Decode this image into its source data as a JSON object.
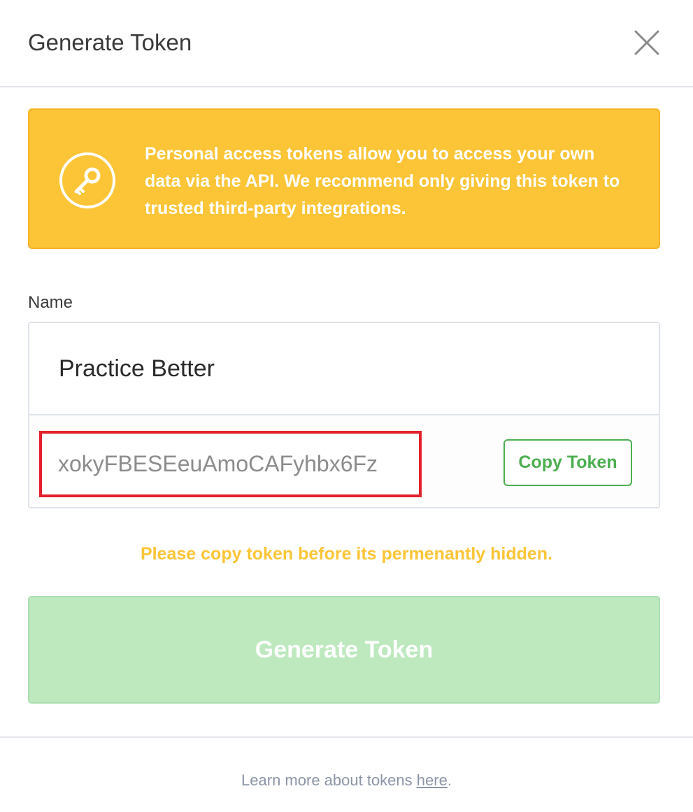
{
  "header": {
    "title": "Generate Token",
    "close_icon": "close-icon"
  },
  "notice": {
    "icon": "key-icon",
    "text": "Personal access tokens allow you to access your own data via the API. We recommend only giving this token to trusted third-party integrations.",
    "background_color": "#fbc537"
  },
  "form": {
    "name_label": "Name",
    "name_value": "Practice Better",
    "token_value": "xokyFBESEeuAmoCAFyhbx6Fz",
    "copy_button_label": "Copy Token"
  },
  "warning_text": "Please copy token before its permenantly hidden.",
  "generate_button_label": "Generate Token",
  "footer": {
    "text_before": "Learn more about tokens ",
    "link_text": "here",
    "text_after": "."
  },
  "colors": {
    "accent_green": "#4caf50",
    "warning_yellow": "#fbc537",
    "highlight_red": "#e4202c"
  }
}
